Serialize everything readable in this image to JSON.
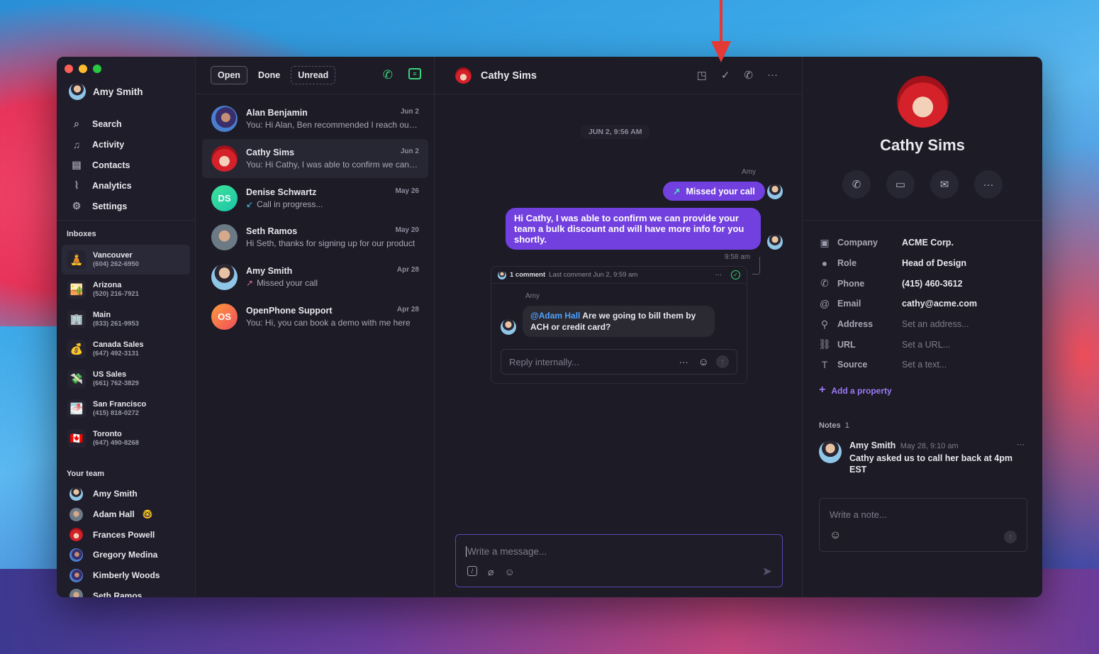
{
  "colors": {
    "accent": "#7340e0",
    "green": "#3bd47a",
    "mention": "#4da3ff",
    "annotation_arrow": "#e53935"
  },
  "sidebar": {
    "user": "Amy Smith",
    "nav": [
      {
        "label": "Search",
        "icon": "search-icon"
      },
      {
        "label": "Activity",
        "icon": "bell-icon"
      },
      {
        "label": "Contacts",
        "icon": "contacts-icon"
      },
      {
        "label": "Analytics",
        "icon": "analytics-icon"
      },
      {
        "label": "Settings",
        "icon": "gear-icon"
      }
    ],
    "inboxes_label": "Inboxes",
    "inboxes": [
      {
        "name": "Vancouver",
        "phone": "(604) 262-6950",
        "emoji": "🧘"
      },
      {
        "name": "Arizona",
        "phone": "(520) 216-7921",
        "emoji": "🏜️"
      },
      {
        "name": "Main",
        "phone": "(833) 261-9953",
        "emoji": "🏢"
      },
      {
        "name": "Canada Sales",
        "phone": "(647) 492-3131",
        "emoji": "💰"
      },
      {
        "name": "US Sales",
        "phone": "(661) 762-3829",
        "emoji": "💸"
      },
      {
        "name": "San Francisco",
        "phone": "(415) 818-0272",
        "emoji": "🌁"
      },
      {
        "name": "Toronto",
        "phone": "(647) 490-8268",
        "emoji": "🇨🇦"
      }
    ],
    "team_label": "Your team",
    "team": [
      {
        "name": "Amy Smith"
      },
      {
        "name": "Adam Hall",
        "emoji": "🤓"
      },
      {
        "name": "Frances Powell"
      },
      {
        "name": "Gregory Medina"
      },
      {
        "name": "Kimberly Woods"
      },
      {
        "name": "Seth Ramos"
      }
    ]
  },
  "list": {
    "tabs": [
      "Open",
      "Done",
      "Unread"
    ],
    "conversations": [
      {
        "name": "Alan Benjamin",
        "date": "Jun 2",
        "preview": "You: Hi Alan, Ben recommended I reach out to you about our services",
        "av": "av-alan"
      },
      {
        "name": "Cathy Sims",
        "date": "Jun 2",
        "preview": "You: Hi Cathy, I was able to confirm we can provide your team",
        "av": "av-cathy"
      },
      {
        "name": "Denise Schwartz",
        "date": "May 26",
        "preview": "Call in progress...",
        "av": "av-ds",
        "initials": "DS",
        "icon": "↙",
        "icon_color": "#3fc8e0"
      },
      {
        "name": "Seth Ramos",
        "date": "May 20",
        "preview": "Hi Seth, thanks for signing up for our product",
        "av": "av-seth"
      },
      {
        "name": "Amy Smith",
        "date": "Apr 28",
        "preview": "Missed your call",
        "av": "av-amy",
        "icon": "↗",
        "icon_color": "#e06aa8"
      },
      {
        "name": "OpenPhone Support",
        "date": "Apr 28",
        "preview": "You: Hi, you can book a demo with me here",
        "av": "av-os",
        "initials": "OS"
      }
    ]
  },
  "chat": {
    "contact": "Cathy Sims",
    "date_divider": "JUN 2, 9:56 AM",
    "sender": "Amy",
    "missed_call": "Missed your call",
    "message": "Hi Cathy, I was able to confirm we can provide your team a bulk discount and will have more info for you shortly.",
    "message_time": "9:58 am",
    "thread": {
      "count": "1 comment",
      "last": "Last comment Jun 2, 9:59 am",
      "sender": "Amy",
      "mention": "@Adam Hall",
      "text": " Are we going to bill them by ACH or credit card?",
      "reply_placeholder": "Reply internally..."
    },
    "composer_placeholder": "Write a message..."
  },
  "profile": {
    "name": "Cathy Sims",
    "properties": [
      {
        "key": "Company",
        "value": "ACME Corp.",
        "icon": "briefcase-icon",
        "glyph": "▣"
      },
      {
        "key": "Role",
        "value": "Head of Design",
        "icon": "person-icon",
        "glyph": "●"
      },
      {
        "key": "Phone",
        "value": "(415) 460-3612",
        "icon": "phone-icon",
        "glyph": "✆"
      },
      {
        "key": "Email",
        "value": "cathy@acme.com",
        "icon": "at-icon",
        "glyph": "@"
      },
      {
        "key": "Address",
        "value": "Set an address...",
        "icon": "pin-icon",
        "glyph": "⚲",
        "placeholder": true
      },
      {
        "key": "URL",
        "value": "Set a URL...",
        "icon": "link-icon",
        "glyph": "⛓",
        "placeholder": true
      },
      {
        "key": "Source",
        "value": "Set a text...",
        "icon": "text-icon",
        "glyph": "T",
        "placeholder": true
      }
    ],
    "add_property": "Add a property",
    "notes_label": "Notes",
    "notes_count": "1",
    "note": {
      "author": "Amy Smith",
      "time": "May 28, 9:10 am",
      "text": "Cathy asked us to call her back at 4pm EST"
    },
    "note_placeholder": "Write a note..."
  }
}
